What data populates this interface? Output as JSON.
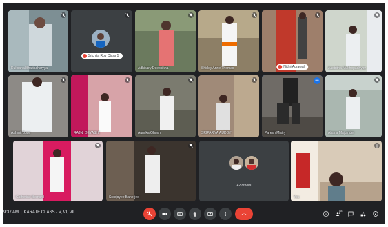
{
  "participants": [
    {
      "name": "Ruksana Bhattacharyya"
    },
    {
      "name": "Srichita Roy Class 5"
    },
    {
      "name": "Adhikary Deepsikha"
    },
    {
      "name": "Shirley Anne Thomas"
    },
    {
      "name": "Nidhi Agrawal"
    },
    {
      "name": "Aastritha Mukhopadhyay"
    },
    {
      "name": "Ashmit Bose"
    },
    {
      "name": "RAJNI DEYASHI"
    },
    {
      "name": "Aumika Ghosh"
    },
    {
      "name": "SRIPARNA AUDDY"
    },
    {
      "name": "Paresh Mistry"
    },
    {
      "name": "Ahana Majumder"
    },
    {
      "name": "Catherine Bernard"
    },
    {
      "name": "Sreejoyee Banerjee"
    },
    {
      "name": "You"
    }
  ],
  "others": {
    "label": "42 others"
  },
  "bottom_bar": {
    "time": "9:37 AM",
    "separator": "|",
    "meeting_title": "KARATE CLASS - V, VI, VII",
    "people_count": "58"
  },
  "colors": {
    "background": "#202124",
    "tile": "#3c4043",
    "accent": "#1a73e8",
    "end_call": "#ea4335"
  }
}
